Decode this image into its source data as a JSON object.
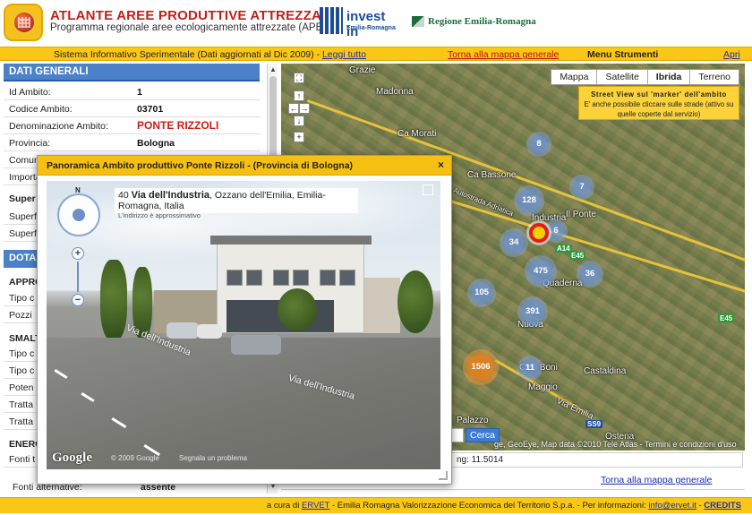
{
  "header": {
    "title": "ATLANTE AREE PRODUTTIVE ATTREZZATE",
    "subtitle": "Programma regionale aree ecologicamente attrezzate (APEA)",
    "investin_line1": "invest in",
    "investin_line2": "Emilia-Romagna",
    "regione": "Regione Emilia-Romagna"
  },
  "topbar": {
    "info": "Sistema Informativo Sperimentale (Dati aggiornati al Dic 2009) - ",
    "read_all": "Leggi tutto",
    "back_to_map": "Torna alla mappa generale",
    "menu": "Menu Strumenti",
    "open": "Apri"
  },
  "left_panel": {
    "section_title": "DATI GENERALI",
    "rows": [
      {
        "key": "Id Ambito:",
        "value": "1"
      },
      {
        "key": "Codice Ambito:",
        "value": "03701"
      },
      {
        "key": "Denominazione Ambito:",
        "value": "PONTE RIZZOLI"
      },
      {
        "key": "Provincia:",
        "value": "Bologna"
      },
      {
        "key": "Comun",
        "value": ""
      },
      {
        "key": "Importa",
        "value": ""
      }
    ],
    "super_title": "Super",
    "super_rows": [
      "Superf",
      "Superf"
    ],
    "dota_title": "DOTA",
    "appro_title": "APPRO",
    "appro_rows": [
      "Tipo c",
      "Pozzi"
    ],
    "smalt_title": "SMALT",
    "smalt_rows": [
      "Tipo c",
      "Tipo c",
      "Poten",
      "Tratta",
      "Tratta"
    ],
    "energ_title": "ENERG",
    "energ_rows": [
      "Fonti t"
    ],
    "fonti_alt_key": "Fonti alternative:",
    "fonti_alt_value": "assente"
  },
  "map": {
    "types": [
      "Mappa",
      "Satellite",
      "Ibrida",
      "Terreno"
    ],
    "active_type": "Ibrida",
    "note_title": "Street View sul 'marker' dell'ambito",
    "note_text": "E' anche possibile cliccare sulle strade (attivo su quelle coperte dal servizio)",
    "places": [
      "Grazie",
      "Madonna",
      "Ca Morati",
      "Ca Bassone",
      "Industria",
      "Il Ponte",
      "Quaderna",
      "Castaldina",
      "Maggio",
      "Ciati Boni",
      "Palazzo",
      "Ostena",
      "Via Emilia",
      "Autostrada Adriatica",
      "Nuova"
    ],
    "clusters": [
      "8",
      "128",
      "7",
      "34",
      "6",
      "475",
      "36",
      "105",
      "391",
      "1506",
      "11"
    ],
    "shields": [
      "A14",
      "E45",
      "E45",
      "SS9"
    ],
    "attribution": "ge, GeoEye, Map data ©2010 Tele Atlas - Termini e condizioni d'uso",
    "search_button": "Cerca",
    "lng": "ng: 11.5014",
    "back_to_map": "Torna alla mappa generale"
  },
  "popup": {
    "title": "Panoramica Ambito produttivo Ponte Rizzoli - (Provincia di Bologna)",
    "close": "×",
    "addr_number": "40",
    "addr_street": "Via dell'Industria",
    "addr_rest": ", Ozzano dell'Emilia, Emilia-Romagna, Italia",
    "addr_note": "L'indirizzo è approssimativo",
    "street_label_1": "Via dell'Industria",
    "street_label_2": "Via dell'Industria",
    "compass_n": "N",
    "google": "Google",
    "copyright": "© 2009 Google",
    "report": "Segnala un problema"
  },
  "footer": {
    "prefix": "a cura di ",
    "ervet": "ERVET",
    "middle": " - Emilia Romagna Valorizzazione Economica del Territorio S.p.a. - Per informazioni: ",
    "email": "info@ervet.it",
    "sep": " - ",
    "credits": "CREDITS"
  }
}
